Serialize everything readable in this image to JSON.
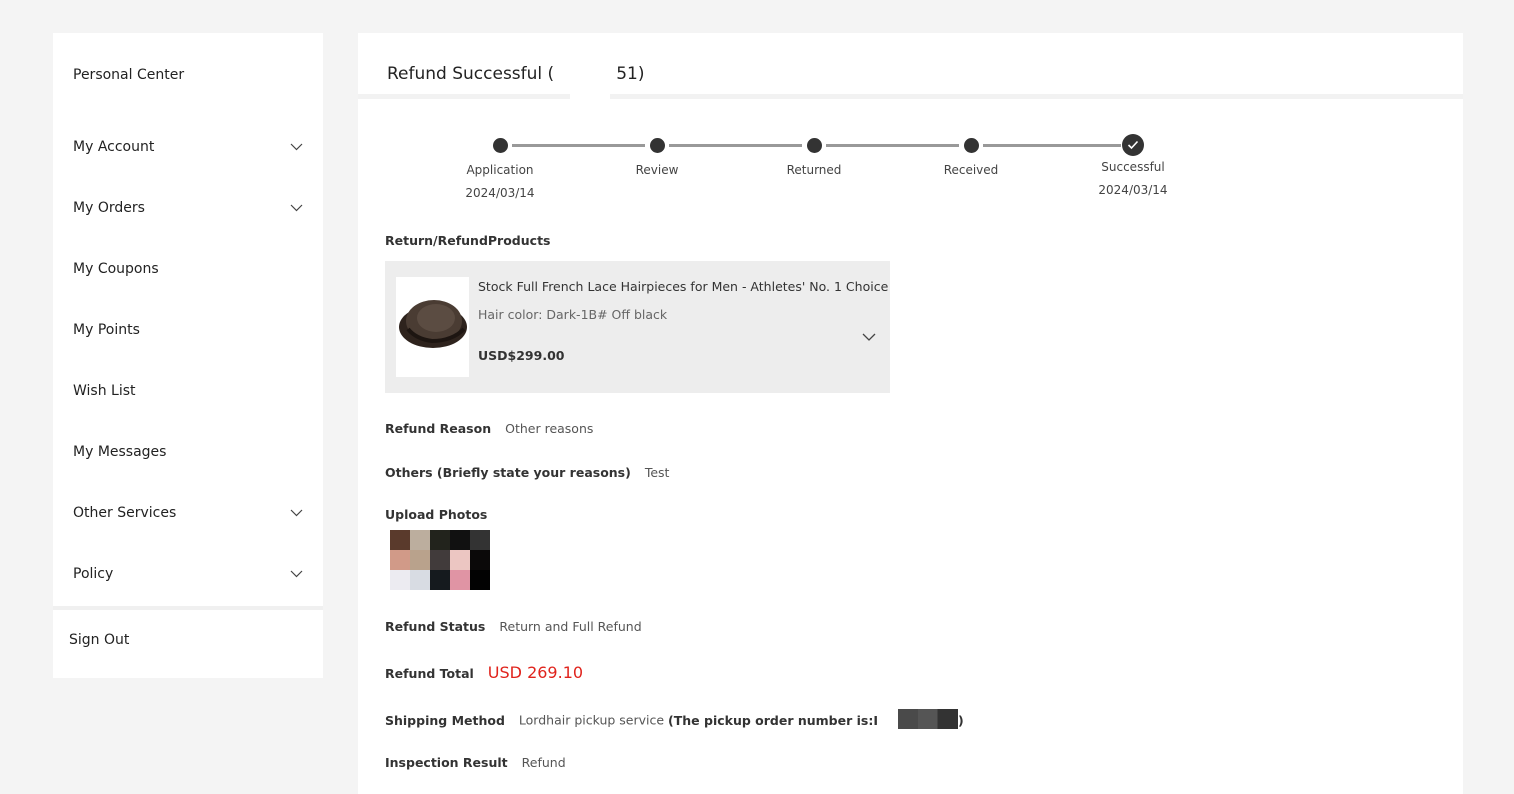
{
  "sidebar": {
    "items": [
      {
        "label": "Personal Center",
        "expandable": false
      },
      {
        "label": "My Account",
        "expandable": true
      },
      {
        "label": "My Orders",
        "expandable": true
      },
      {
        "label": "My Coupons",
        "expandable": false
      },
      {
        "label": "My Points",
        "expandable": false
      },
      {
        "label": "Wish List",
        "expandable": false
      },
      {
        "label": "My Messages",
        "expandable": false
      },
      {
        "label": "Other Services",
        "expandable": true
      },
      {
        "label": "Policy",
        "expandable": true
      }
    ],
    "sign_out": "Sign Out"
  },
  "header": {
    "title_prefix": "Refund Successful (",
    "title_suffix": "51)"
  },
  "stepper": {
    "steps": [
      {
        "label": "Application",
        "date": "2024/03/14",
        "state": "done"
      },
      {
        "label": "Review",
        "date": "",
        "state": "done"
      },
      {
        "label": "Returned",
        "date": "",
        "state": "done"
      },
      {
        "label": "Received",
        "date": "",
        "state": "done"
      },
      {
        "label": "Successful",
        "date": "2024/03/14",
        "state": "complete"
      }
    ]
  },
  "products_section": {
    "title": "Return/RefundProducts",
    "product": {
      "name": "Stock Full French Lace Hairpieces for Men - Athletes' No. 1 Choice",
      "variant": "Hair color: Dark-1B# Off black",
      "price": "USD$299.00"
    }
  },
  "details": {
    "refund_reason": {
      "label": "Refund Reason",
      "value": "Other reasons"
    },
    "others": {
      "label": "Others (Briefly state your reasons)",
      "value": "Test"
    },
    "upload_photos": {
      "label": "Upload Photos"
    },
    "refund_status": {
      "label": "Refund Status",
      "value": "Return and Full Refund"
    },
    "refund_total": {
      "label": "Refund Total",
      "value": "USD 269.10",
      "color": "#e0231c"
    },
    "shipping_method": {
      "label": "Shipping Method",
      "value": "Lordhair pickup service",
      "note_prefix": "(The pickup order number is:I",
      "note_suffix": ")"
    },
    "inspection_result": {
      "label": "Inspection Result",
      "value": "Refund"
    }
  },
  "photo_mosaic_colors": [
    "#5a3a2c",
    "#bcae9e",
    "#22231c",
    "#111111",
    "#333333",
    "#d19a88",
    "#b9a28c",
    "#413b3b",
    "#ecc6c2",
    "#0b0909",
    "#ecebf1",
    "#d8dce3",
    "#151a1e",
    "#e094a4",
    "#020202"
  ]
}
